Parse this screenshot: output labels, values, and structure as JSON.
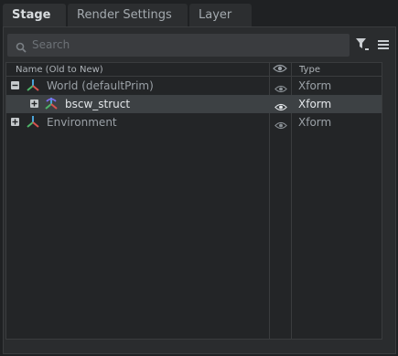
{
  "tabs": [
    {
      "label": "Stage"
    },
    {
      "label": "Render Settings"
    },
    {
      "label": "Layer"
    }
  ],
  "search": {
    "placeholder": "Search"
  },
  "columns": {
    "name": "Name (Old to New)",
    "visibility_icon": "eye-icon",
    "type": "Type"
  },
  "rows": [
    {
      "name": "World (defaultPrim)",
      "type": "Xform",
      "expander": "minus",
      "icon": "xform-icon",
      "selected": false
    },
    {
      "name": "bscw_struct",
      "type": "Xform",
      "expander": "plus",
      "icon": "xform-reference-icon",
      "selected": true
    },
    {
      "name": "Environment",
      "type": "Xform",
      "expander": "plus",
      "icon": "xform-icon",
      "selected": false
    }
  ],
  "toolbar": {
    "filter_icon": "filter-icon",
    "menu_icon": "hamburger-menu-icon"
  }
}
